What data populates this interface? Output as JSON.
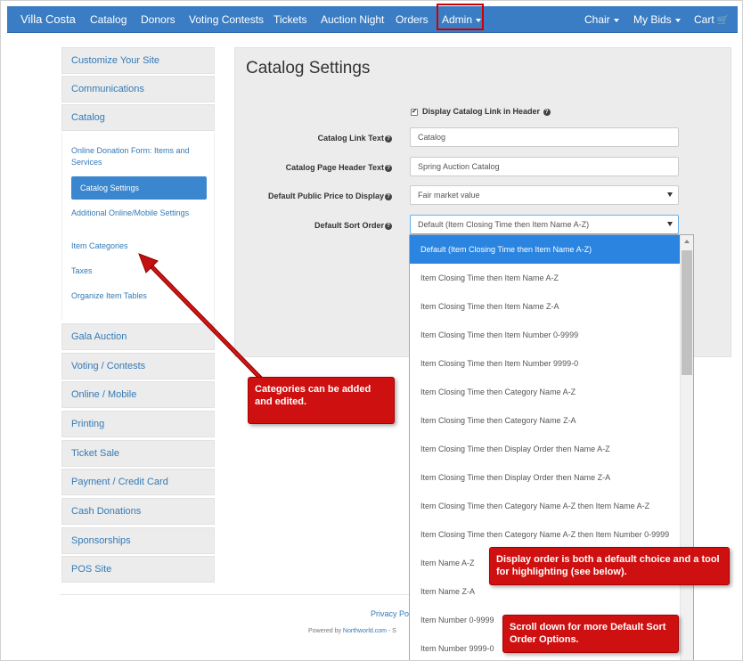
{
  "navbar": {
    "brand": "Villa Costa",
    "items": [
      "Catalog",
      "Donors",
      "Voting Contests",
      "Tickets",
      "Auction Night",
      "Orders"
    ],
    "admin": "Admin",
    "chair": "Chair",
    "my_bids": "My Bids",
    "cart": "Cart",
    "bg_color": "#3a7dc5"
  },
  "sidebar": {
    "top_items": [
      "Customize Your Site",
      "Communications",
      "Catalog"
    ],
    "catalog_sub": {
      "online_donation": "Online Donation Form: Items and Services",
      "active": "Catalog Settings",
      "additional": "Additional Online/Mobile Settings",
      "item_categories": "Item Categories",
      "taxes": "Taxes",
      "organize": "Organize Item Tables"
    },
    "bottom_items": [
      "Gala Auction",
      "Voting / Contests",
      "Online / Mobile",
      "Printing",
      "Ticket Sale",
      "Payment / Credit Card",
      "Cash Donations",
      "Sponsorships",
      "POS Site"
    ]
  },
  "main": {
    "title": "Catalog Settings",
    "checkbox_label": "Display Catalog Link in Header",
    "checkbox_checked": true,
    "fields": {
      "link_text_label": "Catalog Link Text",
      "link_text_value": "Catalog",
      "header_text_label": "Catalog Page Header Text",
      "header_text_value": "Spring Auction Catalog",
      "price_label": "Default Public Price to Display",
      "price_value": "Fair market value",
      "sort_label": "Default Sort Order",
      "sort_value": "Default (Item Closing Time then Item Name A-Z)"
    }
  },
  "dropdown": {
    "selected_index": 0,
    "options": [
      "Default (Item Closing Time then Item Name A-Z)",
      "Item Closing Time then Item Name A-Z",
      "Item Closing Time then Item Name Z-A",
      "Item Closing Time then Item Number 0-9999",
      "Item Closing Time then Item Number 9999-0",
      "Item Closing Time then Category Name A-Z",
      "Item Closing Time then Category Name Z-A",
      "Item Closing Time then Display Order then Name A-Z",
      "Item Closing Time then Display Order then Name Z-A",
      "Item Closing Time then Category Name A-Z then Item Name A-Z",
      "Item Closing Time then Category Name A-Z then Item Number 0-9999",
      "Item Name A-Z",
      "Item Name Z-A",
      "Item Number 0-9999",
      "Item Number 9999-0"
    ],
    "selected_color": "#2a84e0"
  },
  "footer": {
    "privacy": "Privacy Po",
    "powered_prefix": "Powered by ",
    "powered_link": "Northworld.com",
    "powered_suffix": " - S"
  },
  "annotations": {
    "categories": "Categories can be added and edited.",
    "display_order": "Display order is both a default choice and a tool for highlighting (see below).",
    "scroll_down": "Scroll down for more Default Sort Order Options.",
    "color": "#cf1010"
  }
}
